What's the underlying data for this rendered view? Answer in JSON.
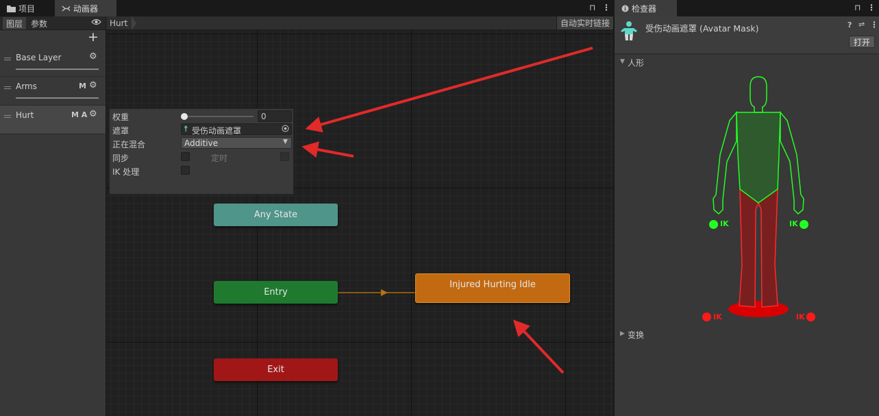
{
  "tabs": {
    "project": "项目",
    "animator": "动画器",
    "inspector": "检查器"
  },
  "left_panel": {
    "tab_layers": "图层",
    "tab_params": "参数",
    "add_symbol": "+",
    "layers": [
      {
        "name": "Base Layer",
        "flags": ""
      },
      {
        "name": "Arms",
        "flags": "M"
      },
      {
        "name": "Hurt",
        "flags": "M A"
      }
    ]
  },
  "graph": {
    "breadcrumb": "Hurt",
    "auto_live_link": "自动实时链接",
    "nodes": {
      "any_state": "Any State",
      "entry": "Entry",
      "exit": "Exit",
      "state": "Injured Hurting Idle"
    },
    "colors": {
      "any_state": "#4f9589",
      "entry": "#1f7a2f",
      "exit": "#a11717",
      "state": "#c26a12",
      "annotation_arrow": "#e12a2a"
    }
  },
  "layer_settings": {
    "weight_label": "权重",
    "weight_value": "0",
    "weight_fraction": 0,
    "mask_label": "遮罩",
    "mask_value": "受伤动画遮罩",
    "blending_label": "正在混合",
    "blending_value": "Additive",
    "sync_label": "同步",
    "timing_label": "定时",
    "ik_label": "IK 处理"
  },
  "inspector": {
    "title": "受伤动画遮罩 (Avatar Mask)",
    "open_button": "打开",
    "humanoid_section": "人形",
    "transform_section": "变换",
    "ik_label": "IK"
  }
}
